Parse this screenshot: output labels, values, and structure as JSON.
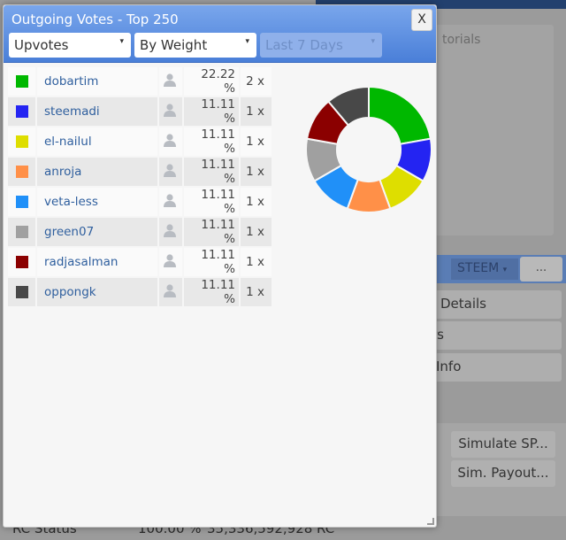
{
  "dialog": {
    "title": "Outgoing Votes - Top 250",
    "close_label": "X",
    "filters": [
      {
        "value": "Upvotes"
      },
      {
        "value": "By Weight"
      },
      {
        "value": "Last 7 Days",
        "disabled": true
      }
    ],
    "rows": [
      {
        "color": "#00b800",
        "name": "dobartim",
        "percent": "22.22 %",
        "count": "2 x",
        "share": 22.22
      },
      {
        "color": "#2424f2",
        "name": "steemadi",
        "percent": "11.11 %",
        "count": "1 x",
        "share": 11.11
      },
      {
        "color": "#dede00",
        "name": "el-nailul",
        "percent": "11.11 %",
        "count": "1 x",
        "share": 11.11
      },
      {
        "color": "#ff9048",
        "name": "anroja",
        "percent": "11.11 %",
        "count": "1 x",
        "share": 11.11
      },
      {
        "color": "#2090f8",
        "name": "veta-less",
        "percent": "11.11 %",
        "count": "1 x",
        "share": 11.11
      },
      {
        "color": "#a0a0a0",
        "name": "green07",
        "percent": "11.11 %",
        "count": "1 x",
        "share": 11.11
      },
      {
        "color": "#8b0000",
        "name": "radjasalman",
        "percent": "11.11 %",
        "count": "1 x",
        "share": 11.11
      },
      {
        "color": "#484848",
        "name": "oppongk",
        "percent": "11.11 %",
        "count": "1 x",
        "share": 11.11
      }
    ]
  },
  "background": {
    "tutorials": "torials",
    "currency": "STEEM",
    "more": "...",
    "buttons": [
      "Details",
      "rs",
      "Info"
    ],
    "simulate_sp": "Simulate SP...",
    "sim_payout": "Sim. Payout...",
    "rc_label": "RC Status",
    "rc_percent": "100.00 %",
    "rc_value": "35,336,592,928 RC"
  }
}
